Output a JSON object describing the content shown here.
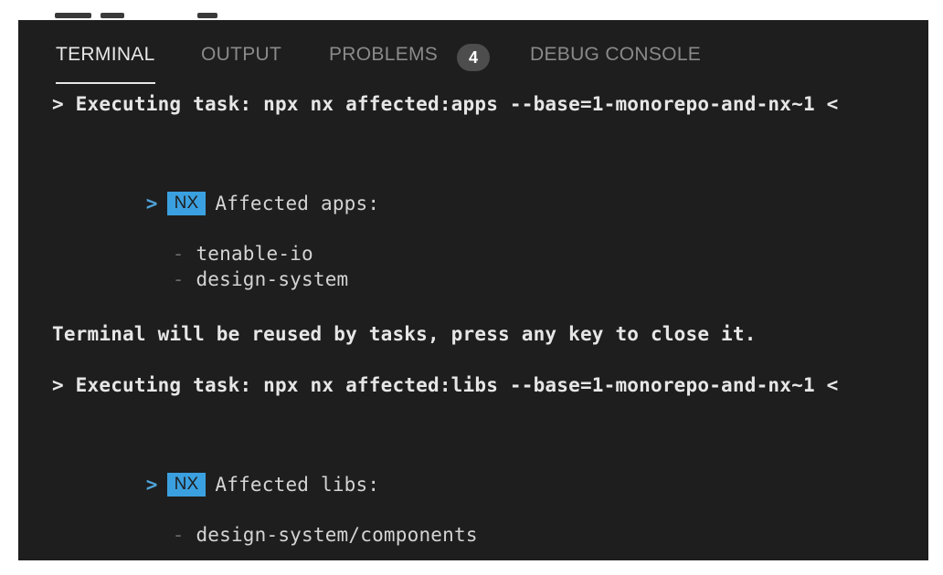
{
  "tabs": {
    "terminal": "TERMINAL",
    "output": "OUTPUT",
    "problems": "PROBLEMS",
    "problems_count": "4",
    "debug_console": "DEBUG CONSOLE"
  },
  "terminal": {
    "task1_line": "> Executing task: npx nx affected:apps --base=1-monorepo-and-nx~1 <",
    "nx_arrow": ">",
    "nx_badge": "NX",
    "apps_heading": "Affected apps:",
    "apps": [
      "tenable-io",
      "design-system"
    ],
    "dash": "-",
    "reuse_message": "Terminal will be reused by tasks, press any key to close it.",
    "task2_line": "> Executing task: npx nx affected:libs --base=1-monorepo-and-nx~1 <",
    "libs_heading": "Affected libs:",
    "libs": [
      "design-system/components"
    ]
  },
  "colors": {
    "panel_bg": "#1e1e1e",
    "nx_badge_bg": "#3ba0e0",
    "prompt_arrow": "#4fa3d9",
    "active_tab": "#e7e7e7",
    "inactive_tab": "#8a8a8a"
  }
}
